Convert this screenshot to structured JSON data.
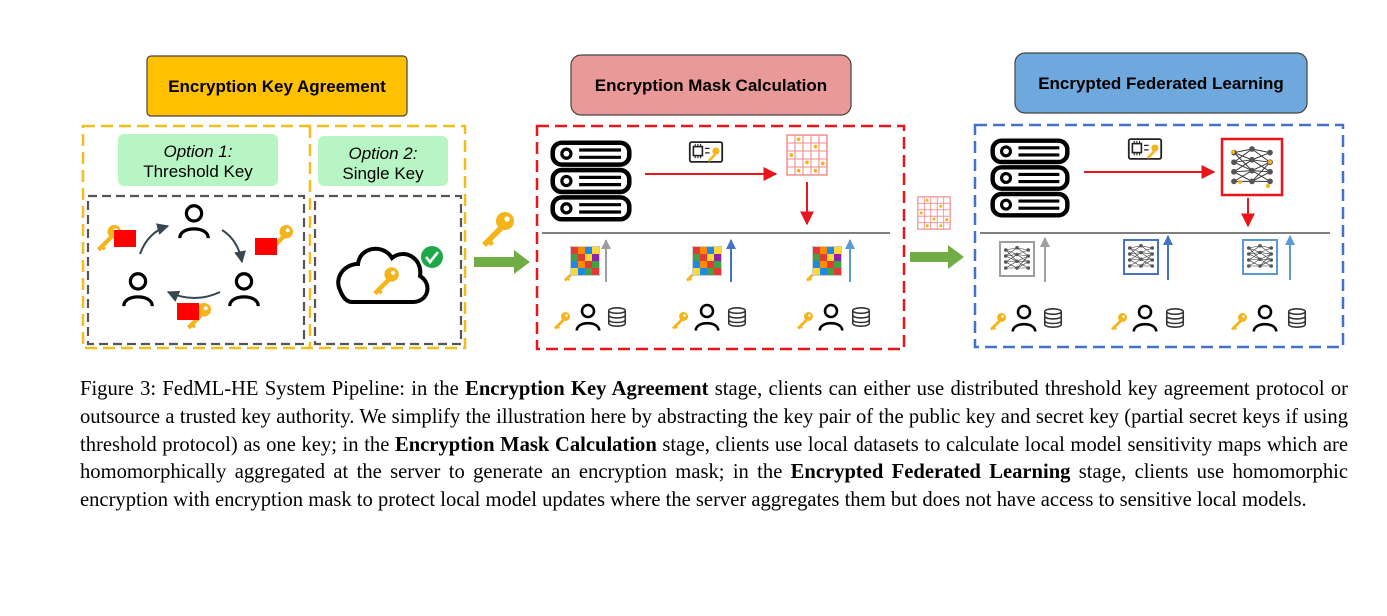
{
  "stages": {
    "key_agreement": {
      "title": "Encryption Key Agreement",
      "option1": {
        "line1": "Option 1:",
        "line2": "Threshold Key"
      },
      "option2": {
        "line1": "Option 2:",
        "line2": "Single Key"
      }
    },
    "mask_calculation": {
      "title": "Encryption Mask Calculation"
    },
    "federated_learning": {
      "title": "Encrypted Federated Learning"
    }
  },
  "colors": {
    "stage1_fill": "#FFC000",
    "stage2_fill": "#EA9999",
    "stage3_fill": "#6FA8DC",
    "option_fill": "#B7F5C4",
    "stage1_border": "#F2BE1B",
    "stage2_border": "#E8161C",
    "stage3_border": "#4472C4",
    "flow_arrow": "#70AD47",
    "key_gold": "#F4B41A",
    "flag_red": "#FF0000",
    "check_green": "#1FA84A"
  },
  "icons": [
    "key-icon",
    "user-icon",
    "server-icon",
    "cloud-icon",
    "check-icon",
    "chip-icon",
    "mask-grid-icon",
    "heatmap-icon",
    "neural-network-icon",
    "database-icon",
    "flag-icon"
  ],
  "caption": {
    "prefix": "Figure 3: FedML-HE System Pipeline: in the ",
    "bold1": "Encryption Key Agreement",
    "mid1": " stage, clients can either use distributed threshold key agreement protocol or outsource a trusted key authority. We simplify the illustration here by abstracting the key pair of the public key and secret key (partial secret keys if using threshold protocol) as one key; in the ",
    "bold2": "Encryption Mask Calculation",
    "mid2": " stage, clients use local datasets to calculate local model sensitivity maps which are homomorphically aggregated at the server to generate an encryption mask; in the ",
    "bold3": "Encrypted Federated Learning",
    "suffix": " stage, clients use homomorphic encryption with encryption mask to protect local model updates where the server aggregates them but does not have access to sensitive local models."
  }
}
